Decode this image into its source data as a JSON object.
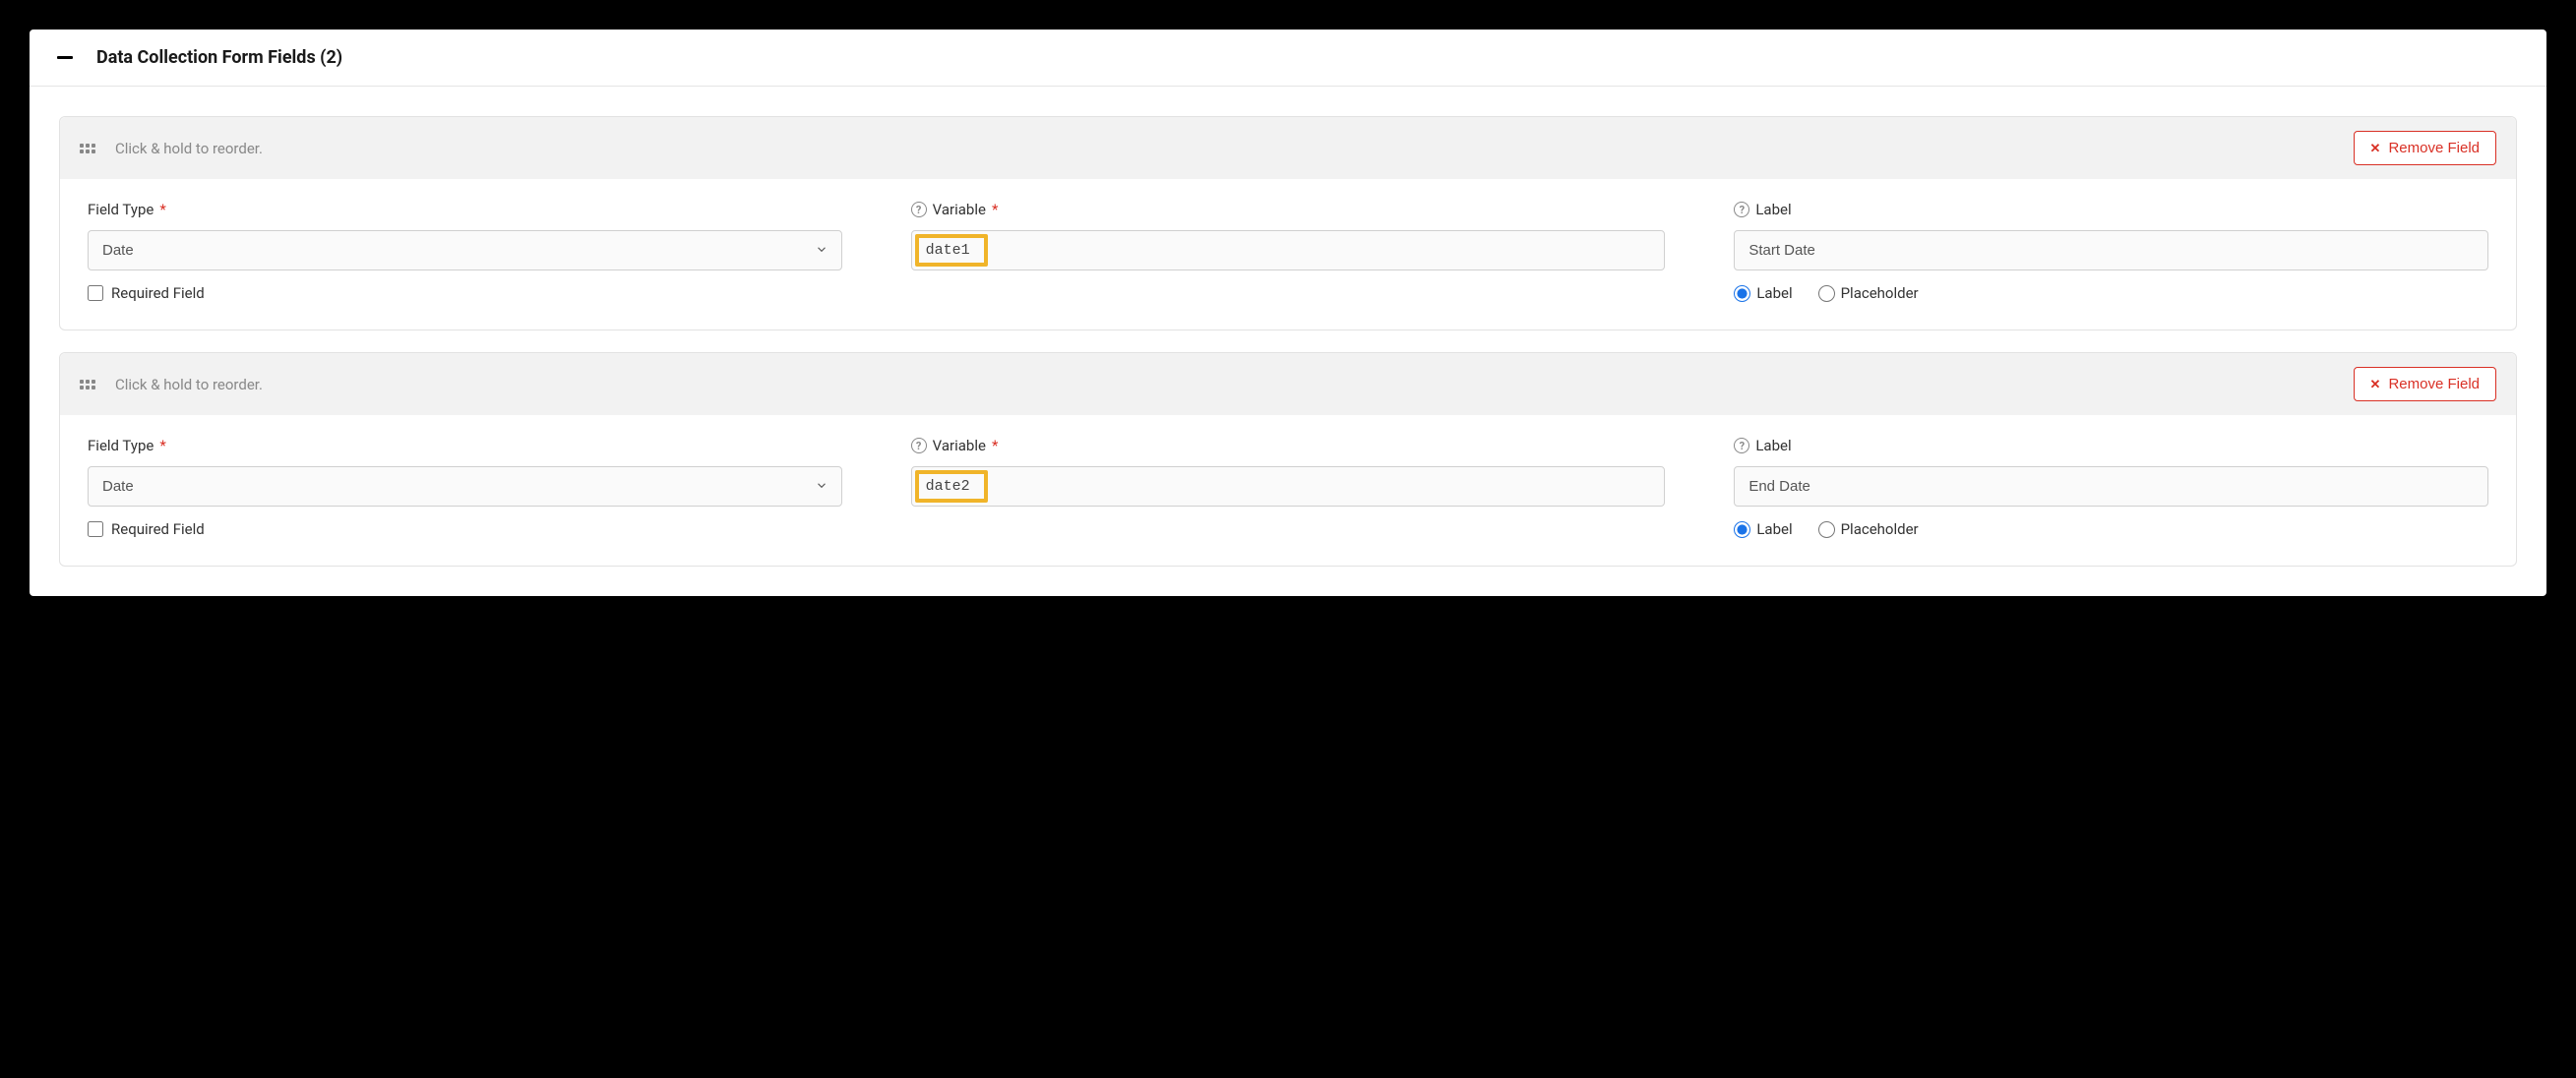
{
  "section": {
    "title": "Data Collection Form Fields (2)"
  },
  "common": {
    "dragText": "Click & hold to reorder.",
    "removeLabel": "Remove Field",
    "fieldTypeLabel": "Field Type",
    "variableLabel": "Variable",
    "labelLabel": "Label",
    "requiredFieldLabel": "Required Field",
    "radioLabelOption": "Label",
    "radioPlaceholderOption": "Placeholder"
  },
  "fields": [
    {
      "fieldType": "Date",
      "variable": "date1",
      "label": "Start Date",
      "required": false,
      "displayMode": "label"
    },
    {
      "fieldType": "Date",
      "variable": "date2",
      "label": "End Date",
      "required": false,
      "displayMode": "label"
    }
  ]
}
